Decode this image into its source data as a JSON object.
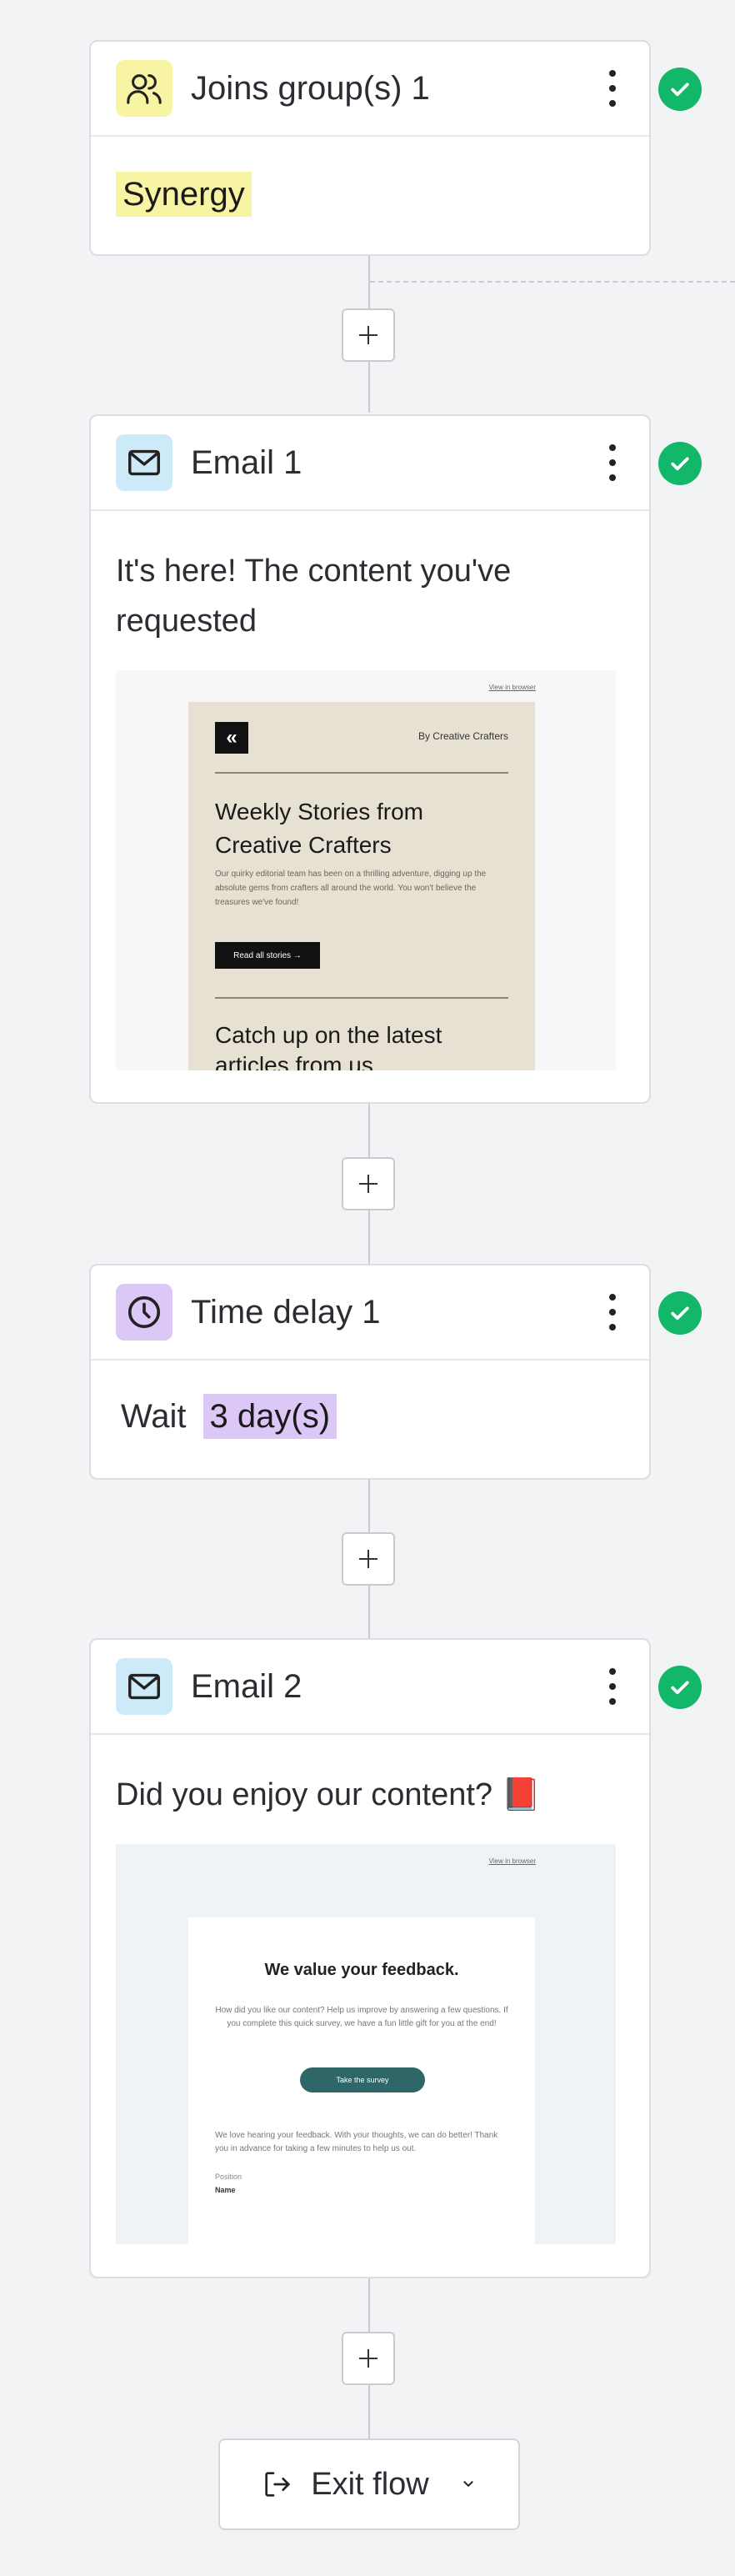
{
  "trigger": {
    "title": "Joins group(s) 1",
    "group_tag": "Synergy"
  },
  "email1": {
    "title": "Email 1",
    "subject": "It's here! The content you've requested",
    "preview": {
      "view_in_browser": "View in browser",
      "byline": "By Creative Crafters",
      "headline": "Weekly Stories from Creative Crafters",
      "body": "Our quirky editorial team has been on a thrilling adventure, digging up the absolute gems from crafters all around the world. You won't believe the treasures we've found!",
      "button": "Read all stories →",
      "headline2": "Catch up on the latest articles from us"
    }
  },
  "delay": {
    "title": "Time delay 1",
    "wait_label": "Wait",
    "duration_tag": "3 day(s)"
  },
  "email2": {
    "title": "Email 2",
    "subject": "Did you enjoy our content? 📕",
    "preview": {
      "view_in_browser": "View in browser",
      "headline": "We value your feedback.",
      "body": "How did you like our content? Help us improve by answering a few questions. If you complete this quick survey, we have a fun little gift for you at the end!",
      "button": "Take the survey",
      "body2": "We love hearing your feedback. With your thoughts, we can do better! Thank you in advance for taking a few minutes to help us out.",
      "field_label": "Position",
      "field_value": "Name"
    }
  },
  "exit": {
    "label": "Exit flow"
  },
  "colors": {
    "trigger_icon_bg": "#f7f5a3",
    "email_icon_bg": "#cdeaf9",
    "delay_icon_bg": "#dcc8f7",
    "group_tag_bg": "#f7f5a3",
    "duration_tag_bg": "#dcc8f7",
    "success": "#12b76a"
  }
}
